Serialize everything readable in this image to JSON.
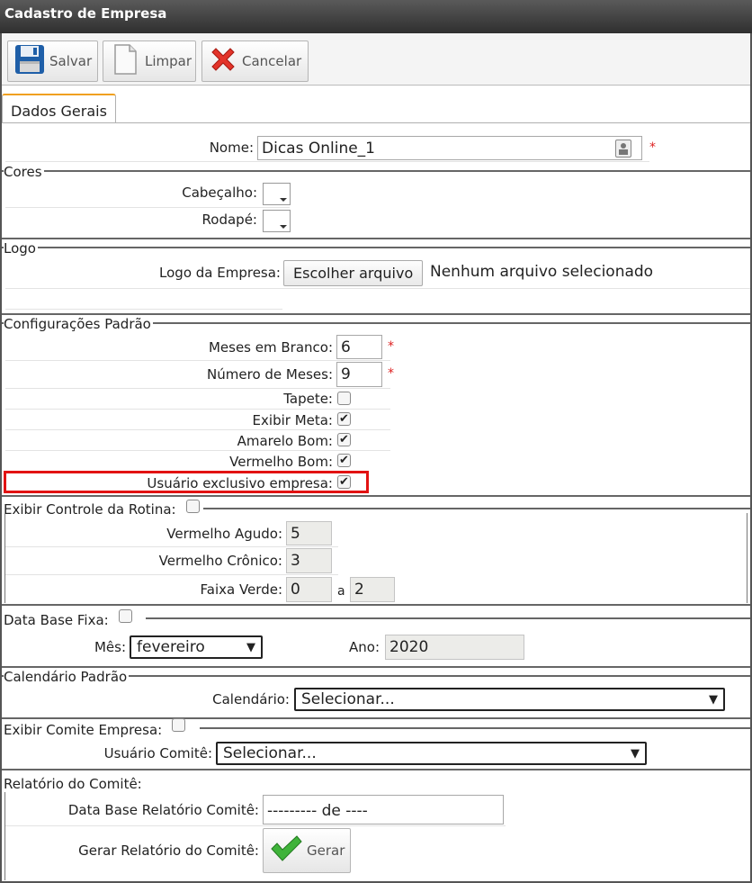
{
  "window": {
    "title": "Cadastro de Empresa"
  },
  "toolbar": {
    "save_label": "Salvar",
    "clear_label": "Limpar",
    "cancel_label": "Cancelar"
  },
  "tabs": [
    {
      "label": "Dados Gerais",
      "active": true
    }
  ],
  "form": {
    "name": {
      "label": "Nome:",
      "value": "Dicas Online_1",
      "required_mark": "*"
    },
    "cores": {
      "title": "Cores",
      "header_label": "Cabeçalho:",
      "footer_label": "Rodapé:"
    },
    "logo": {
      "title": "Logo",
      "label": "Logo da Empresa:",
      "button_label": "Escolher arquivo",
      "status": "Nenhum arquivo selecionado"
    },
    "config": {
      "title": "Configurações Padrão",
      "meses_branco": {
        "label": "Meses em Branco:",
        "value": "6",
        "required_mark": "*"
      },
      "numero_meses": {
        "label": "Número de Meses:",
        "value": "9",
        "required_mark": "*"
      },
      "tapete": {
        "label": "Tapete:",
        "checked": false
      },
      "exibir_meta": {
        "label": "Exibir Meta:",
        "checked": true
      },
      "amarelo_bom": {
        "label": "Amarelo Bom:",
        "checked": true
      },
      "vermelho_bom": {
        "label": "Vermelho Bom:",
        "checked": true
      },
      "usuario_exclusivo": {
        "label": "Usuário exclusivo empresa:",
        "checked": true
      }
    },
    "rotina": {
      "title": "Exibir Controle da Rotina:",
      "vermelho_agudo": {
        "label": "Vermelho Agudo:",
        "value": "5"
      },
      "vermelho_cronico": {
        "label": "Vermelho Crônico:",
        "value": "3"
      },
      "faixa_verde": {
        "label": "Faixa Verde:",
        "from": "0",
        "sep": "a",
        "to": "2"
      }
    },
    "data_base": {
      "title": "Data Base Fixa:",
      "mes_label": "Mês:",
      "mes_value": "fevereiro",
      "ano_label": "Ano:",
      "ano_value": "2020"
    },
    "calendario": {
      "title": "Calendário Padrão",
      "label": "Calendário:",
      "value": "Selecionar..."
    },
    "comite": {
      "title": "Exibir Comite Empresa:",
      "label": "Usuário Comitê:",
      "value": "Selecionar..."
    },
    "relatorio": {
      "title": "Relatório do Comitê:",
      "data_label": "Data Base Relatório Comitê:",
      "data_value": "--------- de ----",
      "gerar_label": "Gerar Relatório do Comitê:",
      "gerar_button": "Gerar"
    }
  },
  "colors": {
    "titlebar": "#3c3c3c",
    "tab_accent": "#f0a020",
    "required": "#d22222",
    "highlight": "#e21212"
  }
}
